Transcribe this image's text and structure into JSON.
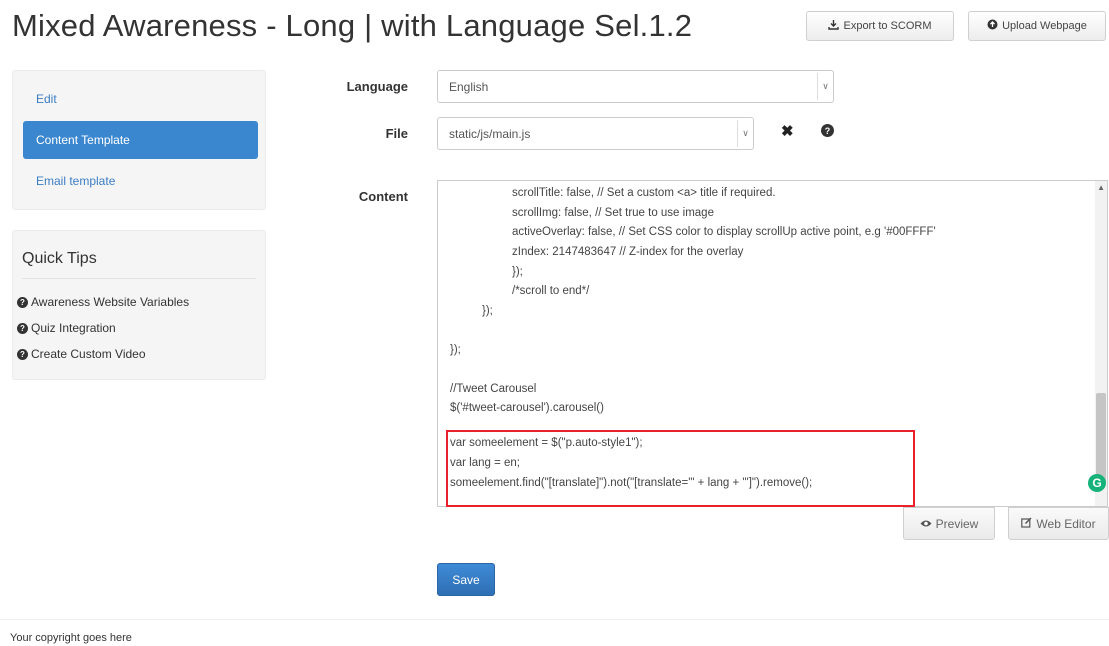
{
  "page": {
    "title": "Mixed Awareness - Long | with Language Sel.1.2"
  },
  "header_buttons": {
    "export": {
      "label": "Export to SCORM",
      "icon": "export-icon"
    },
    "upload": {
      "label": "Upload Webpage",
      "icon": "upload-icon"
    }
  },
  "sidebar": {
    "nav": [
      {
        "label": "Edit",
        "active": false
      },
      {
        "label": "Content Template",
        "active": true
      },
      {
        "label": "Email template",
        "active": false
      }
    ],
    "tips": {
      "title": "Quick Tips",
      "items": [
        {
          "label": "Awareness Website Variables",
          "icon": "question-circle-icon"
        },
        {
          "label": "Quiz Integration",
          "icon": "question-circle-icon"
        },
        {
          "label": "Create Custom Video",
          "icon": "question-circle-icon"
        }
      ]
    }
  },
  "form": {
    "language_label": "Language",
    "language_value": "English",
    "file_label": "File",
    "file_value": "static/js/main.js",
    "content_label": "Content"
  },
  "editor": {
    "lines": [
      "scrollTitle: false, // Set a custom <a> title if required.",
      "scrollImg: false, // Set true to use image",
      "activeOverlay: false, // Set CSS color to display scrollUp active point, e.g '#00FFFF'",
      "zIndex: 2147483647 // Z-index for the overlay",
      "});",
      "/*scroll to end*/",
      "});",
      "});",
      "//Tweet Carousel",
      "$('#tweet-carousel').carousel()",
      "var someelement = $(\"p.auto-style1\");",
      "var lang = en;",
      "someelement.find(\"[translate]\").not(\"[translate='\" + lang + \"']\").remove();"
    ]
  },
  "editor_buttons": {
    "preview": "Preview",
    "web_editor": "Web Editor"
  },
  "save_label": "Save",
  "footer": {
    "text": "Your copyright goes here"
  },
  "colors": {
    "primary": "#3a87d0",
    "highlight_border": "#e8212a",
    "grammarly": "#16b27a"
  }
}
